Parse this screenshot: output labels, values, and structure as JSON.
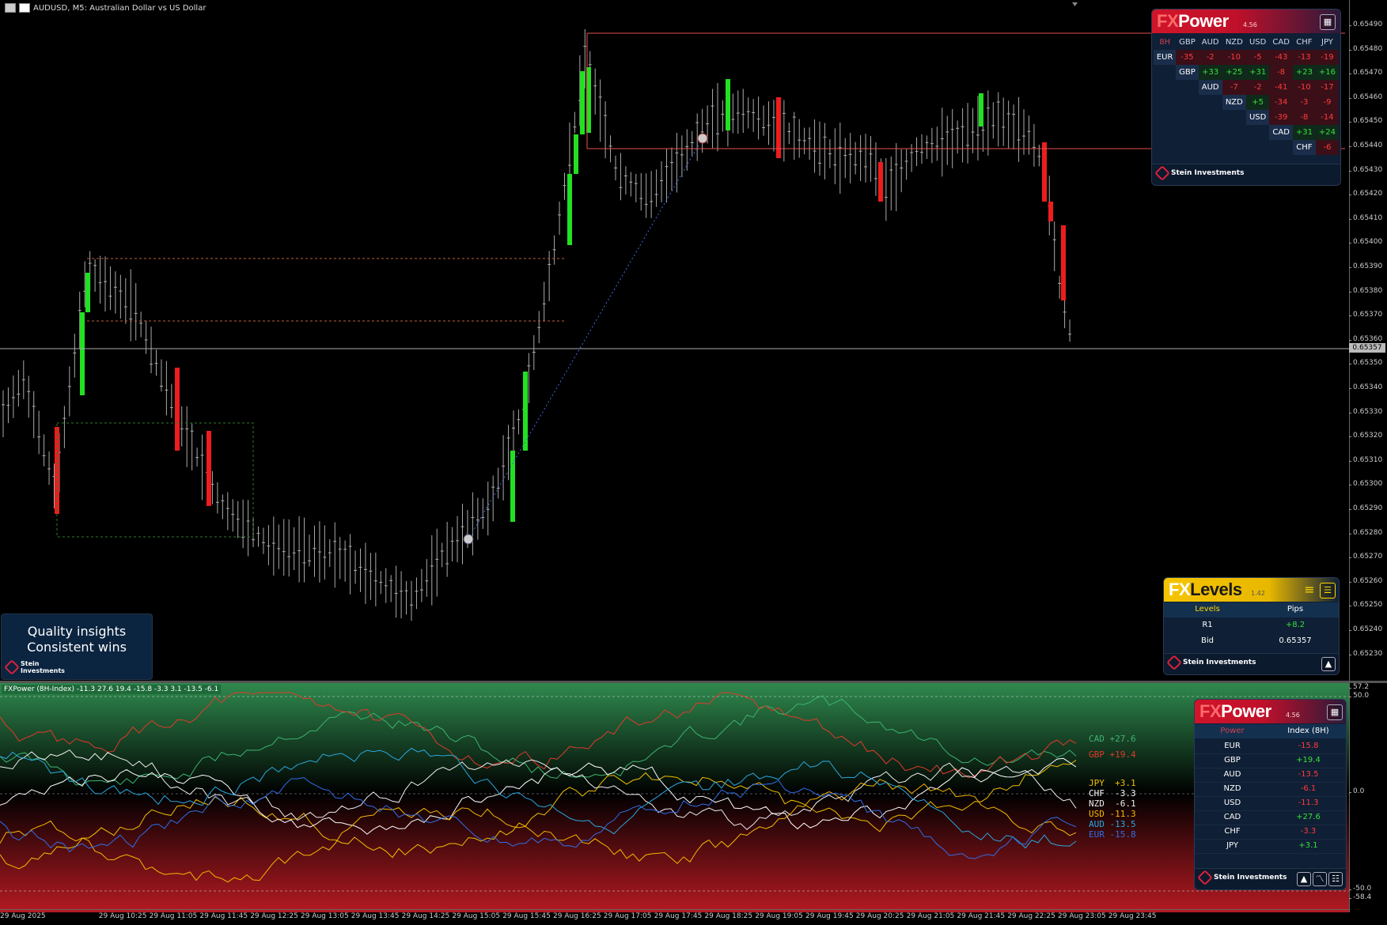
{
  "chart_title": "AUDUSD, M5:  Australian Dollar vs US Dollar",
  "price_scale": [
    "0.65490",
    "0.65480",
    "0.65470",
    "0.65460",
    "0.65450",
    "0.65440",
    "0.65430",
    "0.65420",
    "0.65410",
    "0.65400",
    "0.65390",
    "0.65380",
    "0.65370",
    "0.65360",
    "0.65350",
    "0.65340",
    "0.65330",
    "0.65320",
    "0.65310",
    "0.65300",
    "0.65290",
    "0.65280",
    "0.65270",
    "0.65260",
    "0.65250",
    "0.65240",
    "0.65230"
  ],
  "bid_price_tag": "0.65357",
  "time_axis": [
    "29 Aug 2025",
    "29 Aug 10:25",
    "29 Aug 11:05",
    "29 Aug 11:45",
    "29 Aug 12:25",
    "29 Aug 13:05",
    "29 Aug 13:45",
    "29 Aug 14:25",
    "29 Aug 15:05",
    "29 Aug 15:45",
    "29 Aug 16:25",
    "29 Aug 17:05",
    "29 Aug 17:45",
    "29 Aug 18:25",
    "29 Aug 19:05",
    "29 Aug 19:45",
    "29 Aug 20:25",
    "29 Aug 21:05",
    "29 Aug 21:45",
    "29 Aug 22:25",
    "29 Aug 23:05",
    "29 Aug 23:45"
  ],
  "sub_title": "FXPower (8H-Index) -11.3 27.6 19.4 -15.8 -3.3 3.1 -13.5 -6.1",
  "sub_scale": [
    "57.2",
    "50.0",
    "0.0",
    "-50.0",
    "-58.4"
  ],
  "quality": {
    "line1": "Quality insights",
    "line2": "Consistent wins"
  },
  "fxpower_matrix": {
    "brand_fx": "FX",
    "brand_rest": "Power",
    "version": "4.56",
    "corner": "8H",
    "columns": [
      "GBP",
      "AUD",
      "NZD",
      "USD",
      "CAD",
      "CHF",
      "JPY"
    ],
    "rows": [
      {
        "cur": "EUR",
        "vals": [
          "-35",
          "-2",
          "-10",
          "-5",
          "-43",
          "-13",
          "-19"
        ]
      },
      {
        "cur": "GBP",
        "vals": [
          "+33",
          "+25",
          "+31",
          "-8",
          "+23",
          "+16"
        ]
      },
      {
        "cur": "AUD",
        "vals": [
          "-7",
          "-2",
          "-41",
          "-10",
          "-17"
        ]
      },
      {
        "cur": "NZD",
        "vals": [
          "+5",
          "-34",
          "-3",
          "-9"
        ]
      },
      {
        "cur": "USD",
        "vals": [
          "-39",
          "-8",
          "-14"
        ]
      },
      {
        "cur": "CAD",
        "vals": [
          "+31",
          "+24"
        ]
      },
      {
        "cur": "CHF",
        "vals": [
          "-6"
        ]
      }
    ],
    "footer": "Stein Investments"
  },
  "fxlevels": {
    "brand_fx": "FX",
    "brand_rest": "Levels",
    "version": "1.42",
    "col1": "Levels",
    "col2": "Pips",
    "rows": [
      {
        "a": "R1",
        "b": "+8.2"
      },
      {
        "a": "Bid",
        "b": "0.65357"
      }
    ],
    "footer": "Stein Investments"
  },
  "fxpower_index": {
    "brand_fx": "FX",
    "brand_rest": "Power",
    "version": "4.56",
    "col1": "Power",
    "col2": "Index (8H)",
    "rows": [
      {
        "cur": "EUR",
        "val": "-15.8"
      },
      {
        "cur": "GBP",
        "val": "+19.4"
      },
      {
        "cur": "AUD",
        "val": "-13.5"
      },
      {
        "cur": "NZD",
        "val": "-6.1"
      },
      {
        "cur": "USD",
        "val": "-11.3"
      },
      {
        "cur": "CAD",
        "val": "+27.6"
      },
      {
        "cur": "CHF",
        "val": "-3.3"
      },
      {
        "cur": "JPY",
        "val": "+3.1"
      }
    ],
    "footer": "Stein Investments"
  },
  "currency_labels": [
    {
      "cur": "CAD",
      "val": "+27.6",
      "color": "#3cb371"
    },
    {
      "cur": "GBP",
      "val": "+19.4",
      "color": "#e03a2a"
    },
    {
      "cur": "JPY",
      "val": "+3.1",
      "color": "#f0c000"
    },
    {
      "cur": "CHF",
      "val": "-3.3",
      "color": "#ffffff"
    },
    {
      "cur": "NZD",
      "val": "-6.1",
      "color": "#eeeeee"
    },
    {
      "cur": "USD",
      "val": "-11.3",
      "color": "#f5b800"
    },
    {
      "cur": "AUD",
      "val": "-13.5",
      "color": "#2aa8e0"
    },
    {
      "cur": "EUR",
      "val": "-15.8",
      "color": "#2f6ee8"
    }
  ],
  "colors": {
    "bull": "#22e022",
    "bear": "#ee1c1c",
    "wick": "#bbbbbb",
    "hline": "#e85050"
  }
}
